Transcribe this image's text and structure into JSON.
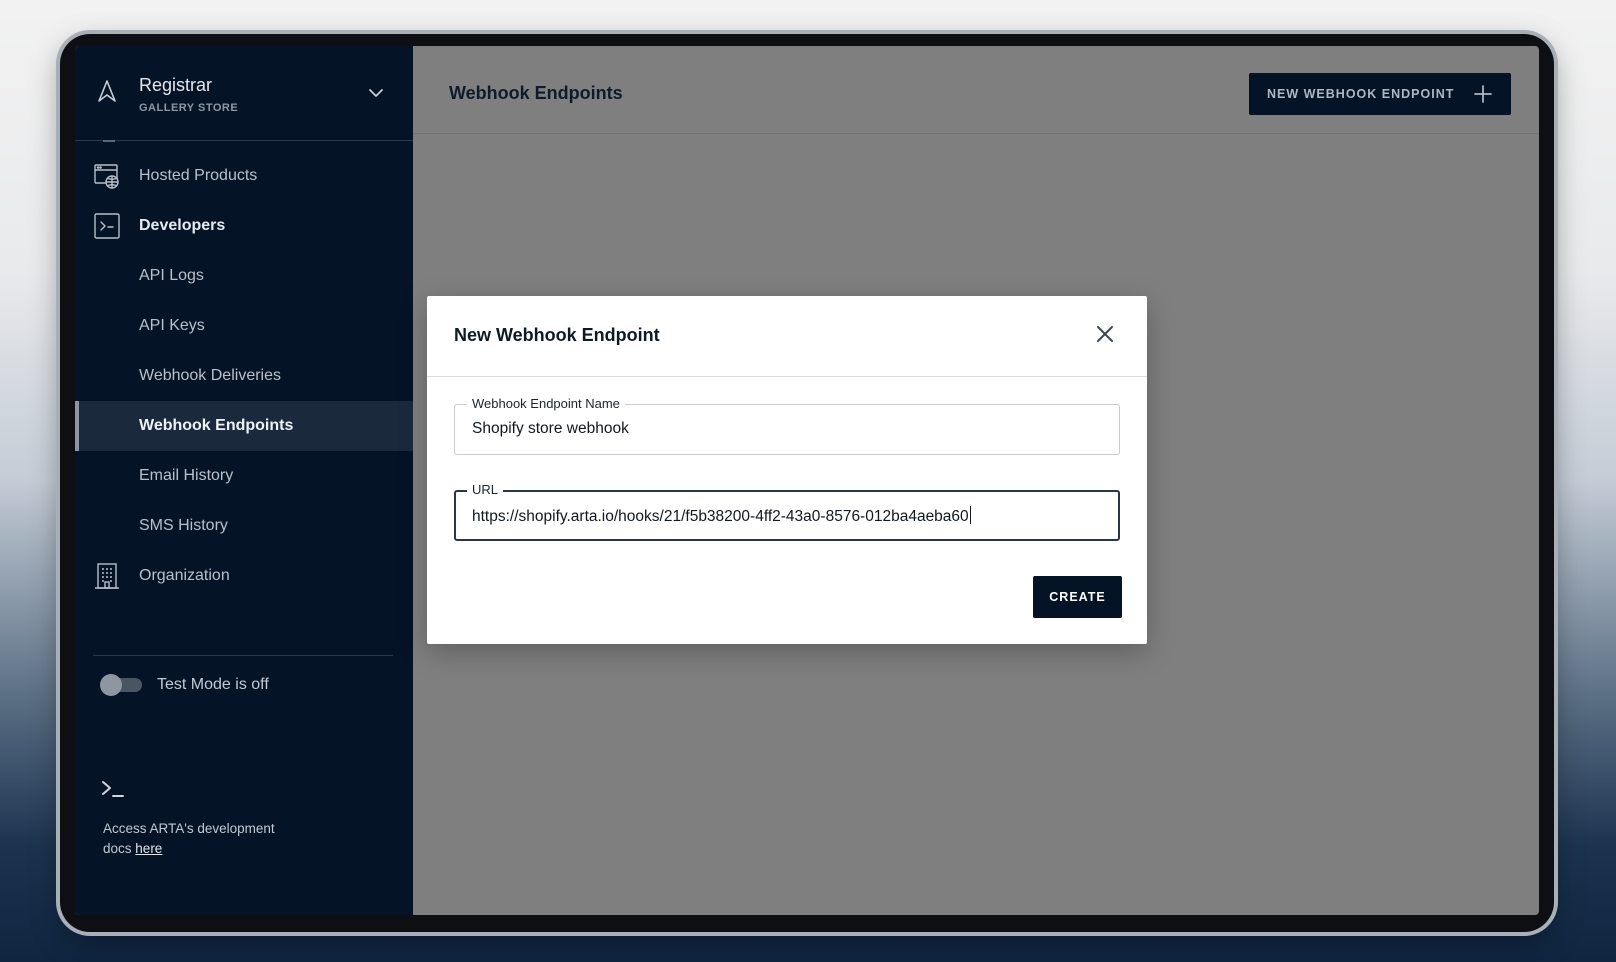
{
  "sidebar": {
    "org": {
      "name": "Registrar",
      "subtitle": "GALLERY STORE"
    },
    "items": [
      {
        "label": "Hosted Products",
        "icon": "browser-globe-icon"
      },
      {
        "label": "Developers",
        "icon": "terminal-box-icon"
      },
      {
        "label": "API Logs"
      },
      {
        "label": "API Keys"
      },
      {
        "label": "Webhook Deliveries"
      },
      {
        "label": "Webhook Endpoints",
        "active": true
      },
      {
        "label": "Email History"
      },
      {
        "label": "SMS History"
      },
      {
        "label": "Organization",
        "icon": "building-icon"
      }
    ],
    "test_mode": {
      "label": "Test Mode is off",
      "on": false
    },
    "docs": {
      "text": "Access ARTA's development docs",
      "link": "here"
    }
  },
  "header": {
    "title": "Webhook Endpoints",
    "new_button_label": "NEW WEBHOOK ENDPOINT"
  },
  "modal": {
    "title": "New Webhook Endpoint",
    "fields": [
      {
        "label": "Webhook Endpoint Name",
        "value": "Shopify store webhook"
      },
      {
        "label": "URL",
        "value": "https://shopify.arta.io/hooks/21/f5b38200-4ff2-43a0-8576-012ba4aeba60"
      }
    ],
    "create_label": "CREATE"
  },
  "colors": {
    "sidebar_bg": "#041426",
    "overlay": "#807f80",
    "primary_button": "#041426"
  }
}
